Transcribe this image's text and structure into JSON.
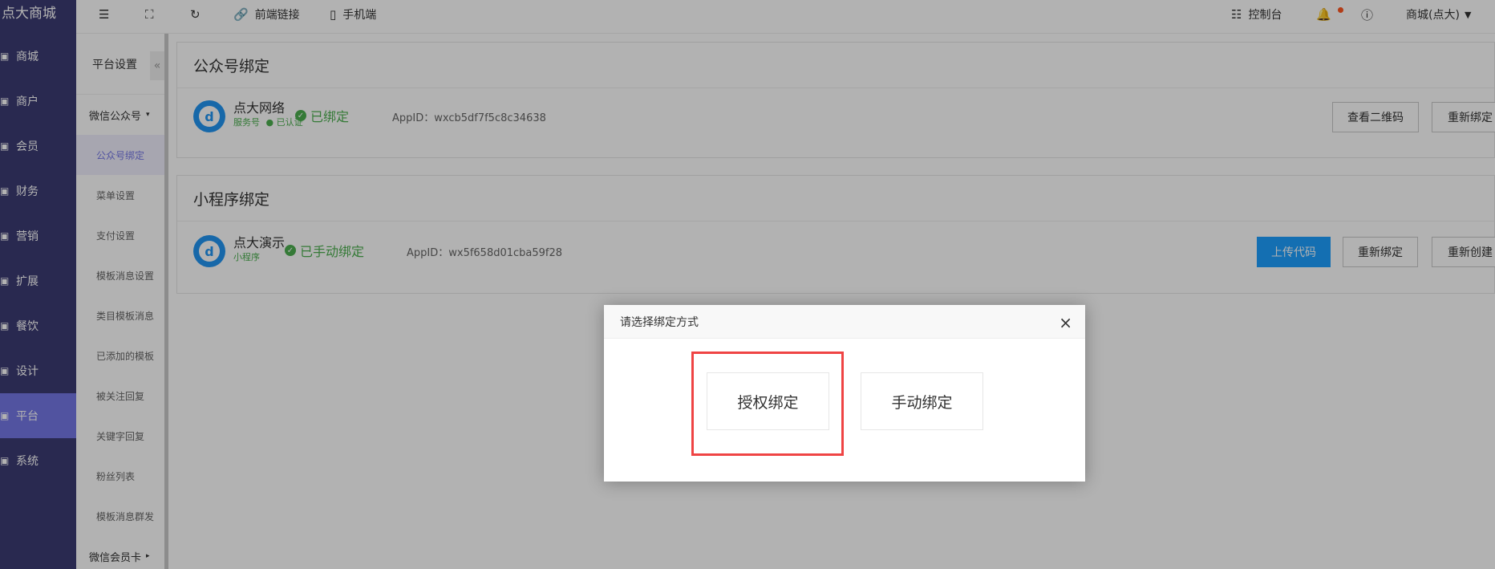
{
  "brand": "点大商城",
  "nav": [
    {
      "label": "商城",
      "icon": "store-icon"
    },
    {
      "label": "商户",
      "icon": "merchant-icon"
    },
    {
      "label": "会员",
      "icon": "member-icon"
    },
    {
      "label": "财务",
      "icon": "finance-icon"
    },
    {
      "label": "营销",
      "icon": "marketing-icon"
    },
    {
      "label": "扩展",
      "icon": "extend-icon"
    },
    {
      "label": "餐饮",
      "icon": "food-icon"
    },
    {
      "label": "设计",
      "icon": "design-icon"
    },
    {
      "label": "平台",
      "icon": "platform-icon",
      "active": true
    },
    {
      "label": "系统",
      "icon": "system-icon"
    }
  ],
  "subnav": {
    "title": "平台设置",
    "collapse": "«",
    "group1": "微信公众号",
    "items": [
      "公众号绑定",
      "菜单设置",
      "支付设置",
      "模板消息设置",
      "类目模板消息",
      "已添加的模板",
      "被关注回复",
      "关键字回复",
      "粉丝列表",
      "模板消息群发"
    ],
    "group2": "微信会员卡"
  },
  "topbar": {
    "frontend_link": "前端链接",
    "mobile": "手机端",
    "console": "控制台",
    "store_user": "商城(点大)"
  },
  "mp_panel": {
    "title": "公众号绑定",
    "name": "点大网络",
    "type": "服务号",
    "verified": "已认证",
    "status": "已绑定",
    "appid": "AppID：wxcb5df7f5c8c34638",
    "btn_qr": "查看二维码",
    "btn_rebind": "重新绑定"
  },
  "mini_panel": {
    "title": "小程序绑定",
    "name": "点大演示",
    "type": "小程序",
    "status": "已手动绑定",
    "appid": "AppID：wx5f658d01cba59f28",
    "btn_upload": "上传代码",
    "btn_rebind": "重新绑定",
    "btn_recreate": "重新创建"
  },
  "modal": {
    "title": "请选择绑定方式",
    "close": "×",
    "auth": "授权绑定",
    "manual": "手动绑定"
  },
  "colors": {
    "sidebar": "#3c3b73",
    "active_nav": "#7577e6",
    "primary": "#1e9fff",
    "success": "#4caf50",
    "highlight": "#ef4444"
  }
}
